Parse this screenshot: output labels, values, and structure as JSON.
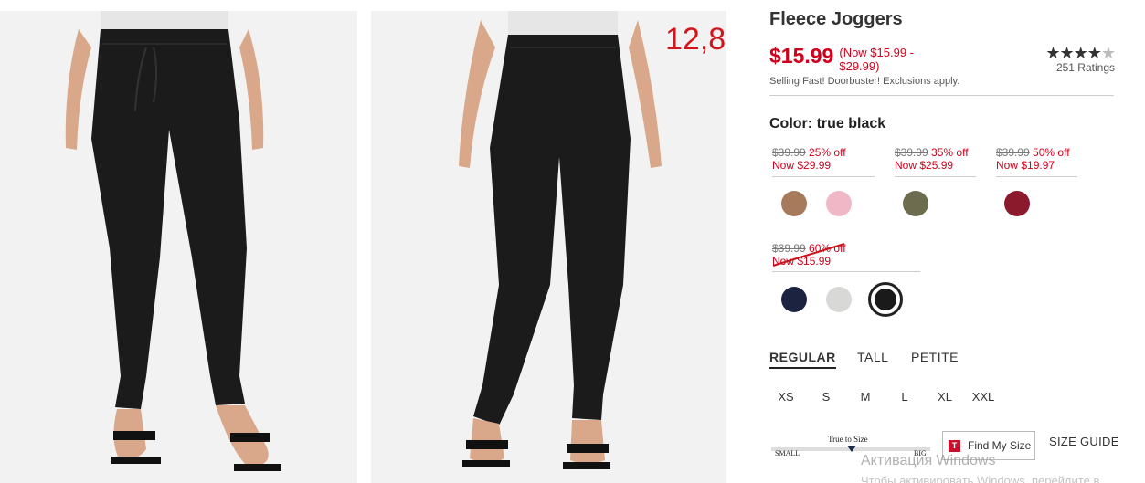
{
  "annotation": "12,8",
  "product": {
    "title": "Fleece Joggers",
    "price": "$15.99",
    "price_range": "(Now $15.99 - $29.99)",
    "promo": "Selling Fast! Doorbuster! Exclusions apply.",
    "stars_full": "★★★★",
    "stars_half": "★",
    "rating_count": "251 Ratings"
  },
  "color": {
    "label": "Color:",
    "value": "true black"
  },
  "price_groups": [
    {
      "was": "$39.99",
      "off": "25% off",
      "now": "Now $29.99",
      "swatches": [
        "#a87a5c",
        "#f0b8c6"
      ]
    },
    {
      "was": "$39.99",
      "off": "35% off",
      "now": "Now $25.99",
      "swatches": [
        "#6e6c4e"
      ]
    },
    {
      "was": "$39.99",
      "off": "50% off",
      "now": "Now $19.97",
      "swatches": [
        "#8b1a2c"
      ]
    },
    {
      "was": "$39.99",
      "off": "60% off",
      "now": "Now $15.99",
      "swatches": [
        "#1c2340",
        "#d8d8d6",
        "#1a1a1a"
      ],
      "selected_index": 2
    }
  ],
  "fit_tabs": [
    "REGULAR",
    "TALL",
    "PETITE"
  ],
  "active_fit": "REGULAR",
  "sizes": [
    "XS",
    "S",
    "M",
    "L",
    "XL",
    "XXL"
  ],
  "fit_scale": {
    "center_label": "True to Size",
    "left_label": "SMALL",
    "right_label": "BIG"
  },
  "find_my_size": {
    "badge": "T",
    "label": "Find My Size"
  },
  "size_guide": "SIZE GUIDE",
  "os_watermark": {
    "line1": "Активация Windows",
    "line2": "Чтобы активировать Windows, перейдите в"
  }
}
